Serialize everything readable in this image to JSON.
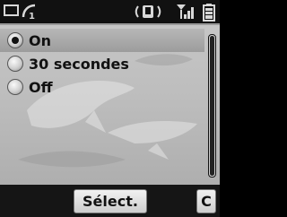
{
  "status_bar": {
    "icons": [
      "message-icon",
      "line-1-icon",
      "vibrate-icon",
      "signal-icon",
      "battery-icon"
    ],
    "line_number": "1"
  },
  "menu": {
    "items": [
      {
        "label": "On",
        "selected": true,
        "checked": true
      },
      {
        "label": "30 secondes",
        "selected": false,
        "checked": false
      },
      {
        "label": "Off",
        "selected": false,
        "checked": false
      }
    ]
  },
  "softkeys": {
    "select_label": "Sélect.",
    "clear_label": "C"
  },
  "colors": {
    "status_bar_bg": "#111111",
    "highlight": "#9c9c9c",
    "text": "#111111"
  }
}
